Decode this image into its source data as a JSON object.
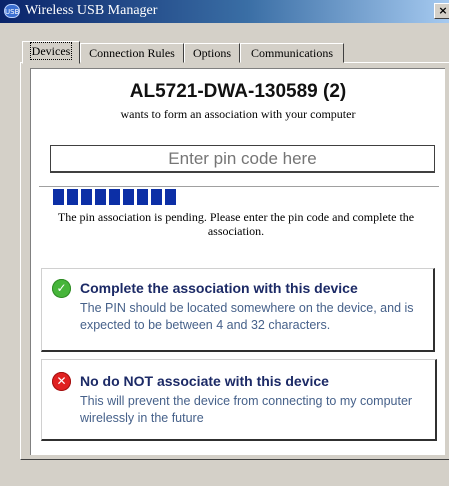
{
  "window": {
    "title": "Wireless USB Manager",
    "icon_name": "usb-icon",
    "icon_text": "USB",
    "close_label": "×"
  },
  "tabs": [
    {
      "label": "Devices",
      "active": true
    },
    {
      "label": "Connection Rules",
      "active": false
    },
    {
      "label": "Options",
      "active": false
    },
    {
      "label": "Communications",
      "active": false
    }
  ],
  "device": {
    "name": "AL5721-DWA-130589 (2)",
    "subtitle": "wants to form an association with your computer"
  },
  "pin": {
    "placeholder": "Enter pin code here"
  },
  "progress": {
    "blocks_filled": 9
  },
  "pending_text": "The pin association is pending. Please enter the pin code and complete the association.",
  "options": [
    {
      "icon": "checkmark-icon",
      "icon_glyph": "✓",
      "title": "Complete the association with this device",
      "description": "The PIN should be located somewhere on the device, and is expected to be between 4 and 32 characters."
    },
    {
      "icon": "cross-icon",
      "icon_glyph": "✕",
      "title": "No do NOT associate with this device",
      "description": "This will prevent the device from connecting to my computer wirelessly in the future"
    }
  ],
  "colors": {
    "titlebar_start": "#0a246a",
    "progress_block": "#0c2fa6",
    "accept_green": "#46b53a",
    "reject_red": "#e02020",
    "option_title": "#1c2a66",
    "option_desc": "#46618a"
  }
}
